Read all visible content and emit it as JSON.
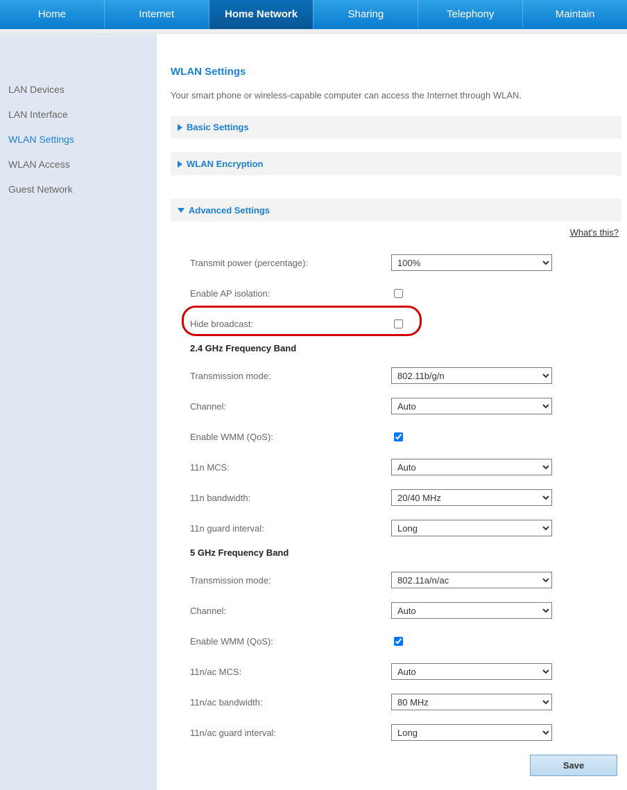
{
  "topnav": {
    "items": [
      "Home",
      "Internet",
      "Home Network",
      "Sharing",
      "Telephony",
      "Maintain"
    ],
    "active_index": 2
  },
  "sidebar": {
    "items": [
      "LAN Devices",
      "LAN Interface",
      "WLAN Settings",
      "WLAN Access",
      "Guest Network"
    ],
    "active_index": 2
  },
  "page": {
    "title": "WLAN Settings",
    "intro": "Your smart phone or wireless-capable computer can access the Internet through WLAN."
  },
  "sections": {
    "basic": "Basic Settings",
    "encryption": "WLAN Encryption",
    "advanced": "Advanced Settings",
    "whats_this": "What's this?"
  },
  "form": {
    "transmit_power_label": "Transmit power (percentage):",
    "transmit_power_value": "100%",
    "enable_ap_isolation_label": "Enable AP isolation:",
    "enable_ap_isolation_checked": false,
    "hide_broadcast_label": "Hide broadcast:",
    "hide_broadcast_checked": false,
    "band24_heading": "2.4 GHz Frequency Band",
    "b24_transmission_mode_label": "Transmission mode:",
    "b24_transmission_mode_value": "802.11b/g/n",
    "b24_channel_label": "Channel:",
    "b24_channel_value": "Auto",
    "b24_enable_wmm_label": "Enable WMM (QoS):",
    "b24_enable_wmm_checked": true,
    "b24_mcs_label": "11n MCS:",
    "b24_mcs_value": "Auto",
    "b24_bandwidth_label": "11n bandwidth:",
    "b24_bandwidth_value": "20/40 MHz",
    "b24_guard_label": "11n guard interval:",
    "b24_guard_value": "Long",
    "band5_heading": "5 GHz Frequency Band",
    "b5_transmission_mode_label": "Transmission mode:",
    "b5_transmission_mode_value": "802.11a/n/ac",
    "b5_channel_label": "Channel:",
    "b5_channel_value": "Auto",
    "b5_enable_wmm_label": "Enable WMM (QoS):",
    "b5_enable_wmm_checked": true,
    "b5_mcs_label": "11n/ac MCS:",
    "b5_mcs_value": "Auto",
    "b5_bandwidth_label": "11n/ac bandwidth:",
    "b5_bandwidth_value": "80 MHz",
    "b5_guard_label": "11n/ac guard interval:",
    "b5_guard_value": "Long"
  },
  "buttons": {
    "save": "Save"
  }
}
